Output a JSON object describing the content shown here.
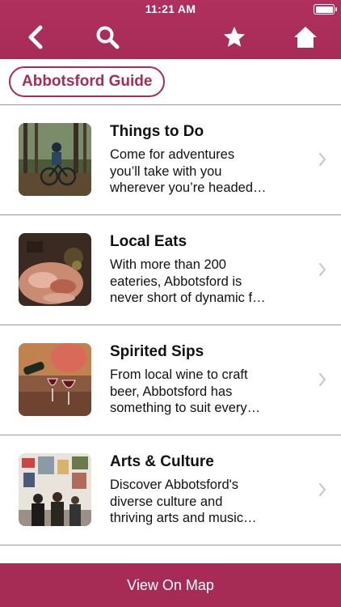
{
  "status_bar": {
    "time": "11:21 AM"
  },
  "nav": {
    "back_icon": "chevron-left-icon",
    "search_icon": "search-icon",
    "favorite_icon": "star-icon",
    "home_icon": "home-icon",
    "bar_color": "#a62c56"
  },
  "guide": {
    "label": "Abbotsford Guide"
  },
  "items": [
    {
      "title": "Things to Do",
      "desc": [
        "Come for adventures",
        "you’ll take with you",
        "wherever you’re headed…"
      ]
    },
    {
      "title": "Local Eats",
      "desc": [
        "With more than 200",
        "eateries, Abbotsford is",
        "never short of dynamic f…"
      ]
    },
    {
      "title": "Spirited Sips",
      "desc": [
        "From local wine to craft",
        "beer, Abbotsford has",
        "something to suit every…"
      ]
    },
    {
      "title": "Arts & Culture",
      "desc": [
        "Discover Abbotsford's",
        "diverse culture and",
        "thriving arts and music…"
      ]
    }
  ],
  "bottom": {
    "label": "View On Map"
  }
}
